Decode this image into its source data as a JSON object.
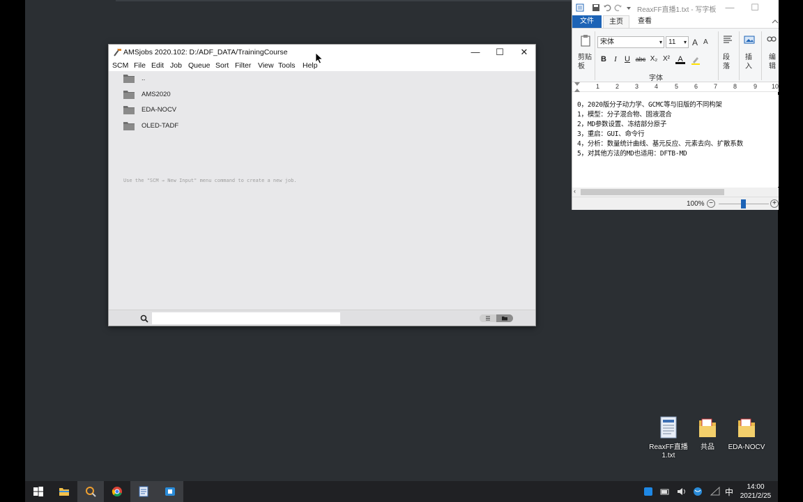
{
  "ams_window": {
    "title": "AMSjobs 2020.102: D:/ADF_DATA/TrainingCourse",
    "controls": {
      "minimize": "—",
      "maximize": "☐",
      "close": "✕"
    },
    "menu": [
      "SCM",
      "File",
      "Edit",
      "Job",
      "Queue",
      "Sort",
      "Filter",
      "View",
      "Tools",
      "Help"
    ],
    "folders": [
      "..",
      "AMS2020",
      "EDA-NOCV",
      "OLED-TADF"
    ],
    "hint": "Use the \"SCM → New Input\" menu command to create a new job.",
    "search": {
      "value": "",
      "placeholder": ""
    }
  },
  "wordpad": {
    "title": "ReaxFF直播1.txt - 写字板",
    "tabs": [
      "文件",
      "主页",
      "查看"
    ],
    "ribbon": {
      "paste_label_1": "剪贴",
      "paste_label_2": "板",
      "font_name": "宋体",
      "font_size": "11",
      "font_group_label": "字体",
      "paragraph_label_1": "段",
      "paragraph_label_2": "落",
      "insert_label_1": "插",
      "insert_label_2": "入",
      "edit_label_1": "编",
      "edit_label_2": "辑",
      "bold": "B",
      "italic": "I",
      "underline": "U",
      "strike": "abc",
      "subscript": "X₂",
      "superscript": "X²",
      "font_color": "A",
      "grow": "A",
      "shrink": "A"
    },
    "ruler": [
      "1",
      "2",
      "3",
      "4",
      "5",
      "6",
      "7",
      "8",
      "9",
      "10"
    ],
    "lines": [
      "0，2020版分子动力学、GCMC等与旧版的不同构架",
      "1，模型：分子混合物、固液混合",
      "2，MD参数设置、冻结部分原子",
      "3，重启：GUI、命令行",
      "4，分析：数量统计曲线、基元反应、元素去向、扩散系数",
      "5，对其他方法的MD也适用：DFTB-MD"
    ],
    "zoom": "100%"
  },
  "desktop_icons": [
    {
      "label_1": "ReaxFF直播",
      "label_2": "1.txt",
      "icon": "text-file-icon"
    },
    {
      "label_1": "共品",
      "label_2": "",
      "icon": "folder-icon"
    },
    {
      "label_1": "EDA-NOCV",
      "label_2": "",
      "icon": "folder-icon"
    }
  ],
  "taskbar": {
    "items": [
      "start-icon",
      "file-explorer-icon",
      "amsjobs-icon",
      "chrome-icon",
      "wordpad-icon",
      "app-icon"
    ],
    "ime": "中",
    "time": "14:00",
    "date": "2021/2/25"
  },
  "colors": {
    "accent": "#1c63b6",
    "desktop": "#2b2f33",
    "taskbar": "#202124"
  }
}
